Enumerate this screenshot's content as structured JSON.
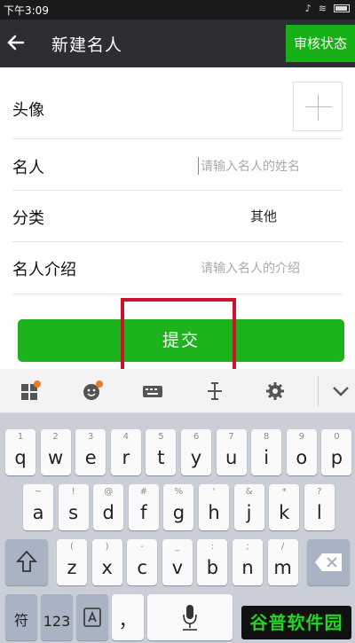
{
  "status_bar": {
    "time": "下午3:09"
  },
  "header": {
    "title": "新建名人",
    "review_status": "审核状态"
  },
  "form": {
    "avatar_label": "头像",
    "name_label": "名人",
    "name_placeholder": "请输入名人的姓名",
    "category_label": "分类",
    "category_value": "其他",
    "intro_label": "名人介绍",
    "intro_placeholder": "请输入名人的介绍"
  },
  "submit_label": "提交",
  "keyboard": {
    "row1": [
      {
        "main": "q",
        "sub": "1"
      },
      {
        "main": "w",
        "sub": "2"
      },
      {
        "main": "e",
        "sub": "3"
      },
      {
        "main": "r",
        "sub": "4"
      },
      {
        "main": "t",
        "sub": "5"
      },
      {
        "main": "y",
        "sub": "6"
      },
      {
        "main": "u",
        "sub": "7"
      },
      {
        "main": "i",
        "sub": "8"
      },
      {
        "main": "o",
        "sub": "9"
      },
      {
        "main": "p",
        "sub": "0"
      }
    ],
    "row2": [
      {
        "main": "a",
        "sub": "~"
      },
      {
        "main": "s",
        "sub": "!"
      },
      {
        "main": "d",
        "sub": "@"
      },
      {
        "main": "f",
        "sub": "#"
      },
      {
        "main": "g",
        "sub": "%"
      },
      {
        "main": "h",
        "sub": "'"
      },
      {
        "main": "j",
        "sub": "&"
      },
      {
        "main": "k",
        "sub": "*"
      },
      {
        "main": "l",
        "sub": "?"
      }
    ],
    "row3": [
      {
        "main": "z",
        "sub": "("
      },
      {
        "main": "x",
        "sub": ")"
      },
      {
        "main": "c",
        "sub": "-"
      },
      {
        "main": "v",
        "sub": "_"
      },
      {
        "main": "b",
        "sub": ":"
      },
      {
        "main": "n",
        "sub": ";"
      },
      {
        "main": "m",
        "sub": "/"
      }
    ],
    "symbols_key": "符",
    "numbers_key": "123",
    "comma_key": "，"
  },
  "watermark": "谷普软件园",
  "colors": {
    "accent_green": "#1db31d",
    "toolbar_dark": "#2e2e32",
    "highlight_red": "#c8142c"
  }
}
